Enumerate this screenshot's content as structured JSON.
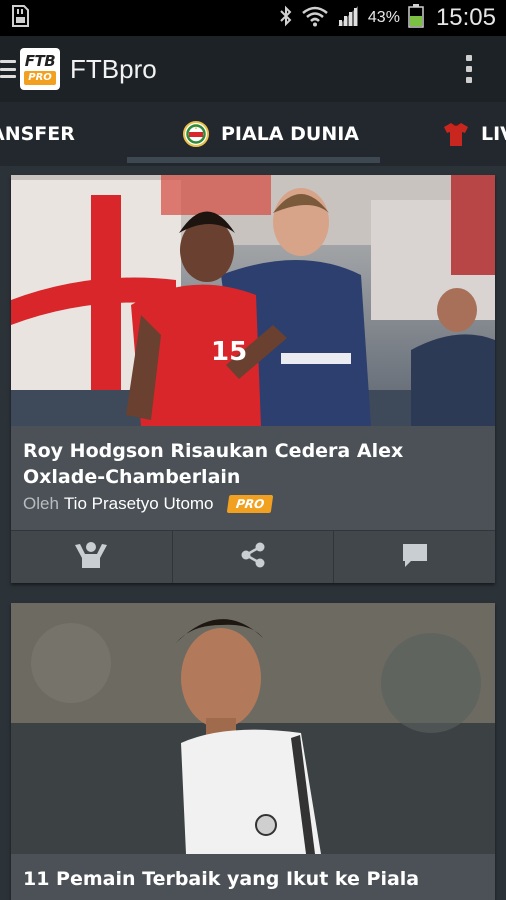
{
  "status_bar": {
    "battery_pct": "43%",
    "time": "15:05",
    "icons": [
      "sd-card-icon",
      "bluetooth-icon",
      "wifi-icon",
      "signal-icon",
      "battery-icon"
    ]
  },
  "app_bar": {
    "logo_top": "FTB",
    "logo_bottom": "PRO",
    "title": "FTBpro"
  },
  "tabs": [
    {
      "label": "ANSFER",
      "selected": false
    },
    {
      "label": "PIALA DUNIA",
      "selected": true
    },
    {
      "label": "LIV",
      "selected": false
    }
  ],
  "articles": [
    {
      "title": "Roy Hodgson Risaukan Cedera Alex Oxlade-Chamberlain",
      "byline_prefix": "Oleh",
      "author": "Tio Prasetyo Utomo",
      "badge": "PRO",
      "actions": [
        "cheer-icon",
        "share-icon",
        "comment-icon"
      ]
    },
    {
      "title": "11 Pemain Terbaik yang Ikut ke Piala"
    }
  ],
  "colors": {
    "accent": "#f2a020",
    "app_bar": "#1d2226",
    "card_text_bg": "#4b5156",
    "action_bg": "#42474c"
  }
}
